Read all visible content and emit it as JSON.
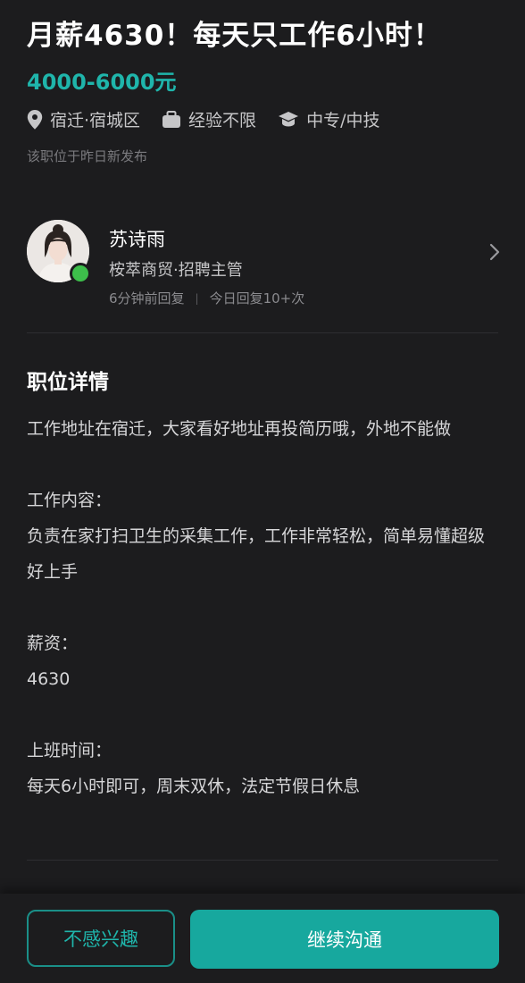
{
  "job": {
    "title": "月薪4630！每天只工作6小时！",
    "salary": "4000-6000元",
    "location": "宿迁·宿城区",
    "experience": "经验不限",
    "education": "中专/中技",
    "posted": "该职位于昨日新发布"
  },
  "recruiter": {
    "name": "苏诗雨",
    "company_role": "桉萃商贸·招聘主管",
    "reply_time": "6分钟前回复",
    "reply_sep": "|",
    "reply_count": "今日回复10+次"
  },
  "details": {
    "heading": "职位详情",
    "address": "工作地址在宿迁，大家看好地址再投简历哦，外地不能做",
    "content_label": "工作内容：",
    "content": "负责在家打扫卫生的采集工作，工作非常轻松，简单易懂超级好上手",
    "pay_label": "薪资：",
    "pay": "4630",
    "hours_label": "上班时间：",
    "hours": "每天6小时即可，周末双休，法定节假日休息"
  },
  "actions": {
    "not_interested": "不感兴趣",
    "continue_chat": "继续沟通"
  },
  "colors": {
    "accent": "#1fb5ab",
    "background": "#1c1c1e",
    "online": "#3dbf4b"
  }
}
